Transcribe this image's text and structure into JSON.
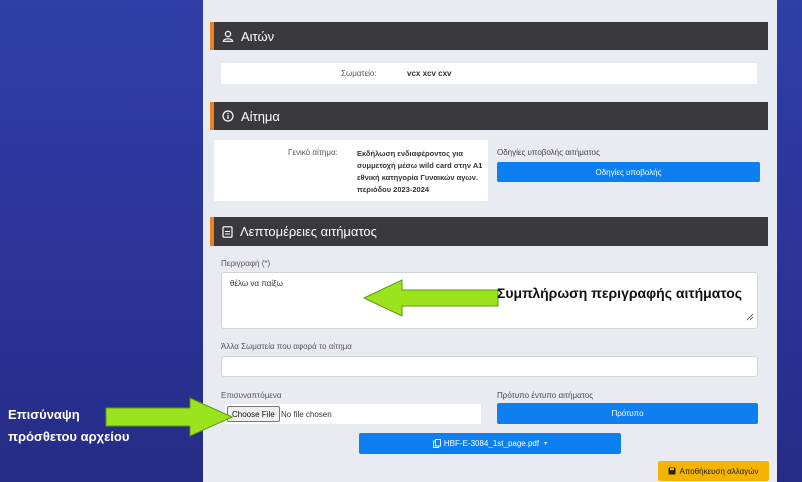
{
  "sections": {
    "aiton": {
      "title": "Αιτών",
      "icon": "user-icon"
    },
    "aitima": {
      "title": "Αίτημα",
      "icon": "info-icon"
    },
    "details": {
      "title": "Λεπτομέρειες αιτήματος",
      "icon": "document-icon"
    }
  },
  "aiton": {
    "club_label": "Σωματείο:",
    "club_value": "vcx xcv cxv"
  },
  "aitima": {
    "general_label": "Γενικό αίτημα:",
    "general_value": "Εκδήλωση ενδιαφέροντος για συμμετοχή μέσω wild card στην Α1 εθνική κατηγορία Γυναικών αγων. περιόδου 2023-2024",
    "instructions_label": "Οδηγίες υποβολής αιτήματος",
    "instructions_button": "Οδηγίες υποβολής"
  },
  "details": {
    "description_label": "Περιγραφή (*)",
    "description_value": "θέλω να παίξω",
    "other_clubs_label": "Άλλα Σωματεία που αφορά το αίτημα",
    "other_clubs_value": "",
    "attachments_label": "Επισυναπτόμενα",
    "choose_file_button": "Choose File",
    "no_file_text": "No file chosen",
    "template_label": "Πρότυπο έντυπο αιτήματος",
    "template_button": "Πρότυπο",
    "attached_file_button": "HBF-E-3084_1st_page.pdf",
    "save_button": "Αποθήκευση αλλαγών"
  },
  "annotations": {
    "description_hint": "Συμπλήρωση περιγραφής αιτήματος",
    "attach_hint_line1": "Επισύναψη",
    "attach_hint_line2": "πρόσθετου αρχείου"
  },
  "colors": {
    "accent_orange": "#f07f22",
    "button_blue": "#0d7ff0",
    "save_yellow": "#f5b400",
    "arrow_green": "#9be31c",
    "header_dark": "#3a3a3c"
  }
}
